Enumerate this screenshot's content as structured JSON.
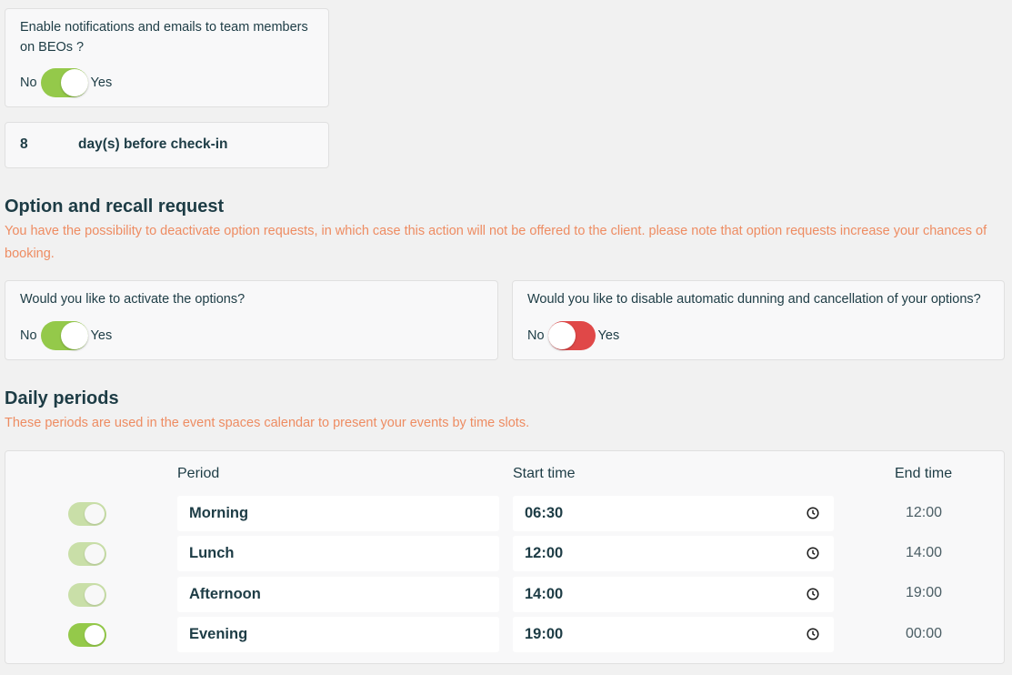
{
  "notifications": {
    "question": "Enable notifications and emails to team members on BEOs ?",
    "no_label": "No",
    "yes_label": "Yes",
    "enabled": true
  },
  "days_before": {
    "value": "8",
    "suffix": "day(s) before check-in"
  },
  "option_section": {
    "title": "Option and recall request",
    "description": "You have the possibility to deactivate option requests, in which case this action will not be offered to the client. please note that option requests increase your chances of booking.",
    "activate": {
      "question": "Would you like to activate the options?",
      "no_label": "No",
      "yes_label": "Yes",
      "enabled": true
    },
    "disable_dunning": {
      "question": "Would you like to disable automatic dunning and cancellation of your options?",
      "no_label": "No",
      "yes_label": "Yes",
      "enabled": false
    }
  },
  "daily_periods": {
    "title": "Daily periods",
    "description": "These periods are used in the event spaces calendar to present your events by time slots.",
    "columns": {
      "period": "Period",
      "start": "Start time",
      "end": "End time"
    },
    "rows": [
      {
        "name": "Morning",
        "start": "06:30",
        "end": "12:00",
        "active": true,
        "editable": false
      },
      {
        "name": "Lunch",
        "start": "12:00",
        "end": "14:00",
        "active": true,
        "editable": false
      },
      {
        "name": "Afternoon",
        "start": "14:00",
        "end": "19:00",
        "active": true,
        "editable": false
      },
      {
        "name": "Evening",
        "start": "19:00",
        "end": "00:00",
        "active": true,
        "editable": true
      }
    ]
  },
  "colors": {
    "accent_green": "#94c94a",
    "accent_green_pale": "#c9dfa8",
    "danger_red": "#e04848",
    "description_orange": "#ee8c62",
    "text_dark": "#1d3c45"
  },
  "icons": {
    "time_picker": "clock-icon"
  }
}
